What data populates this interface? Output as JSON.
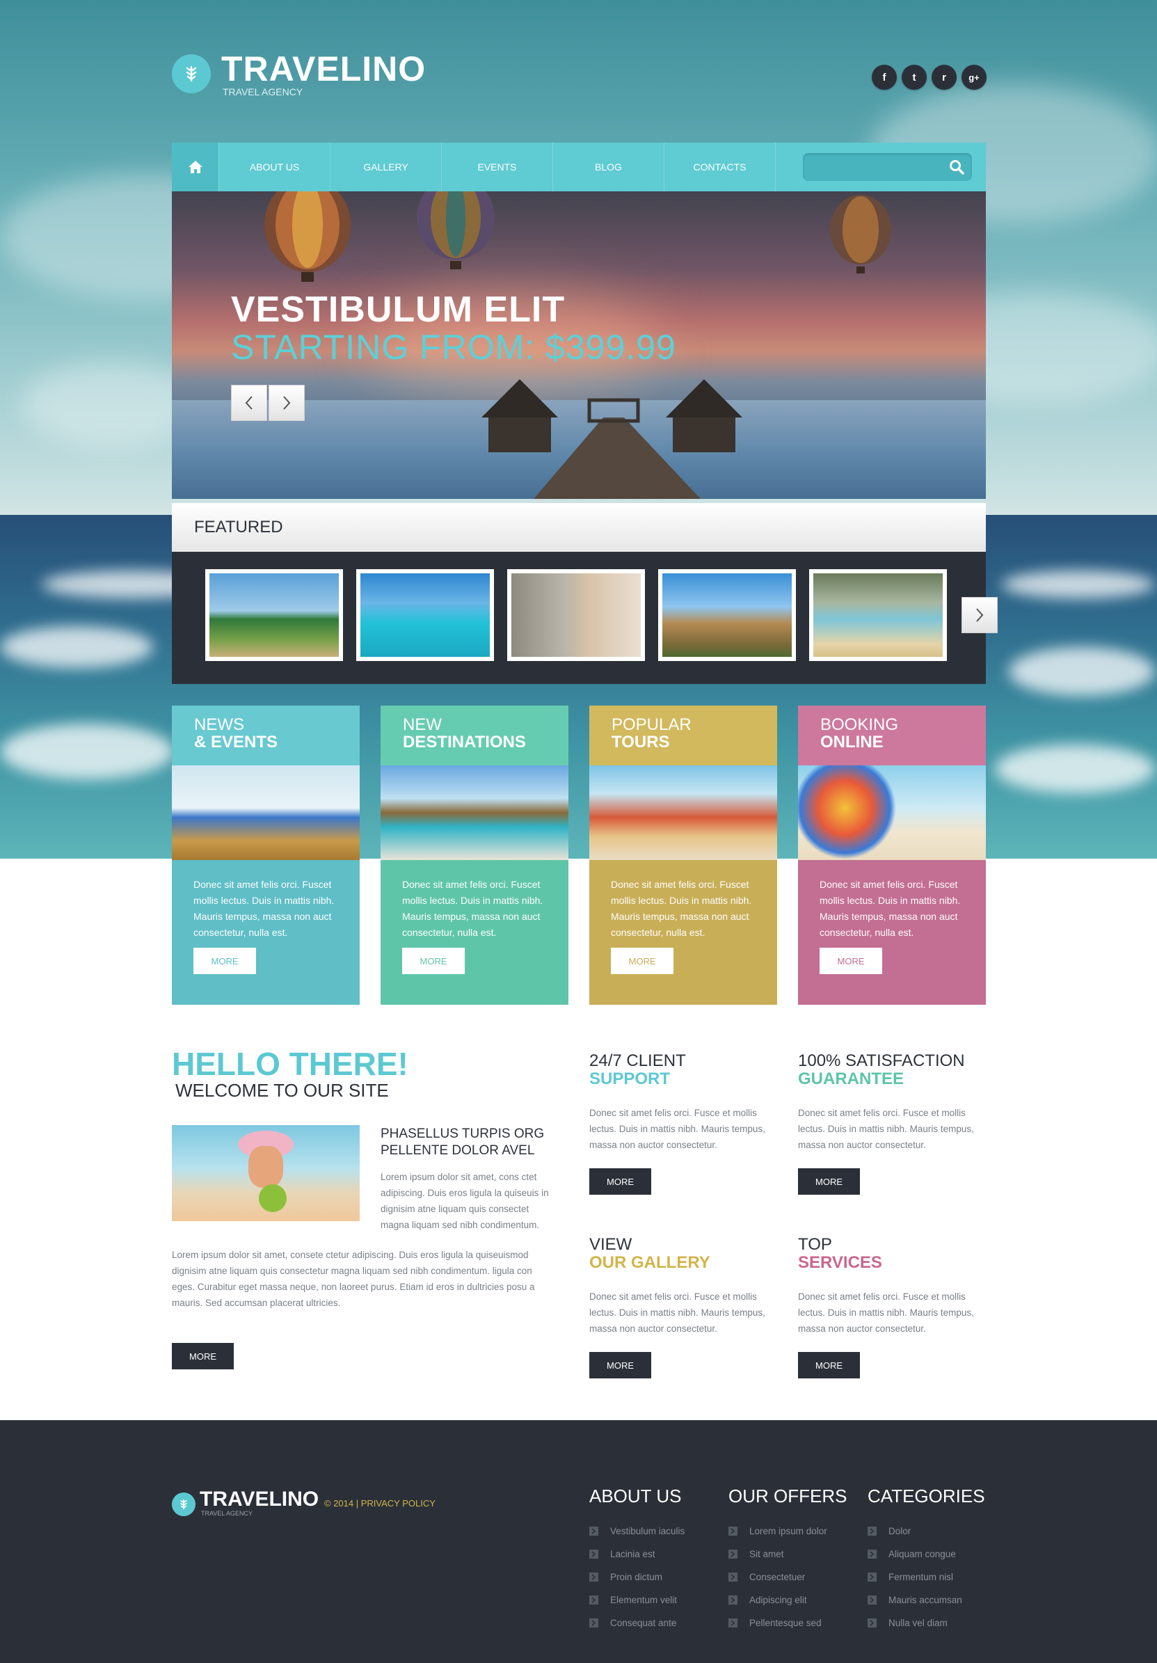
{
  "header": {
    "logo_title": "TRAVELINO",
    "logo_subtitle": "TRAVEL AGENCY",
    "social": [
      {
        "icon": "facebook-icon",
        "glyph": "f"
      },
      {
        "icon": "twitter-icon",
        "glyph": "t"
      },
      {
        "icon": "rss-icon",
        "glyph": "r"
      },
      {
        "icon": "google-plus-icon",
        "glyph": "g+"
      }
    ]
  },
  "nav": {
    "home_icon": "home-icon",
    "items": [
      "ABOUT US",
      "GALLERY",
      "EVENTS",
      "BLOG",
      "CONTACTS"
    ],
    "search_placeholder": ""
  },
  "hero": {
    "title": "VESTIBULUM ELIT",
    "subtitle": "STARTING FROM: $399.99"
  },
  "featured": {
    "title": "FEATURED"
  },
  "cards": [
    {
      "line1": "NEWS",
      "line2": "& EVENTS",
      "text": "Donec sit amet felis orci. Fuscet mollis lectus. Duis in mattis nibh. Mauris tempus, massa non auct consectetur, nulla est.",
      "button": "MORE",
      "color": "#5fbec6"
    },
    {
      "line1": "NEW",
      "line2": "DESTINATIONS",
      "text": "Donec sit amet felis orci. Fuscet mollis lectus. Duis in mattis nibh. Mauris tempus, massa non auct consectetur, nulla est.",
      "button": "MORE",
      "color": "#5fc5a9"
    },
    {
      "line1": "POPULAR",
      "line2": "TOURS",
      "text": "Donec sit amet felis orci. Fuscet mollis lectus. Duis in mattis nibh. Mauris tempus, massa non auct consectetur, nulla est.",
      "button": "MORE",
      "color": "#c8ae57"
    },
    {
      "line1": "BOOKING",
      "line2": "ONLINE",
      "text": "Donec sit amet felis orci. Fuscet mollis lectus. Duis in mattis nibh. Mauris tempus, massa non auct consectetur, nulla est.",
      "button": "MORE",
      "color": "#c36e93"
    }
  ],
  "hello": {
    "title": "HELLO THERE!",
    "subtitle": "WELCOME TO OUR SITE",
    "side_title_1": "PHASELLUS TURPIS ORG",
    "side_title_2": "PELLENTE DOLOR AVEL",
    "side_text": "Lorem ipsum dolor sit amet, cons ctet adipiscing. Duis eros ligula la quiseuis in dignisim atne liquam quis consectet magna liquam sed nibh condimentum.",
    "text": "Lorem ipsum dolor sit amet, consete ctetur adipiscing. Duis eros ligula la quiseuismod dignisim atne liquam quis consectetur magna liquam sed nibh condimentum. ligula con eges. Curabitur eget massa neque, non laoreet purus. Etiam id eros in dultricies posu a mauris. Sed accumsan placerat ultricies.",
    "button": "MORE"
  },
  "features": [
    {
      "line1": "24/7 CLIENT",
      "line2": "SUPPORT",
      "color": "#5cc9d2",
      "text": "Donec sit amet felis orci. Fusce et mollis lectus. Duis in mattis nibh. Mauris tempus, massa non auctor consectetur.",
      "button": "MORE"
    },
    {
      "line1": "100% SATISFACTION",
      "line2": "GUARANTEE",
      "color": "#5cc6a6",
      "text": "Donec sit amet felis orci. Fusce et mollis lectus. Duis in mattis nibh. Mauris tempus, massa non auctor consectetur.",
      "button": "MORE"
    },
    {
      "line1": "VIEW",
      "line2": "OUR GALLERY",
      "color": "#d2b54a",
      "text": "Donec sit amet felis orci. Fusce et mollis lectus. Duis in mattis nibh. Mauris tempus, massa non auctor consectetur.",
      "button": "MORE"
    },
    {
      "line1": "TOP",
      "line2": "SERVICES",
      "color": "#c9678f",
      "text": "Donec sit amet felis orci. Fusce et mollis lectus. Duis in mattis nibh. Mauris tempus, massa non auctor consectetur.",
      "button": "MORE"
    }
  ],
  "footer": {
    "logo_title": "TRAVELINO",
    "logo_subtitle": "TRAVEL AGENCY",
    "copyright": "© 2014 | PRIVACY POLICY",
    "columns": [
      {
        "title": "ABOUT US",
        "links": [
          "Vestibulum iaculis",
          "Lacinia est",
          "Proin dictum",
          "Elementum velit",
          "Consequat ante"
        ]
      },
      {
        "title": "OUR OFFERS",
        "links": [
          "Lorem ipsum dolor",
          "Sit amet",
          "Consectetuer",
          "Adipiscing elit",
          "Pellentesque sed"
        ]
      },
      {
        "title": "CATEGORIES",
        "links": [
          "Dolor",
          "Aliquam congue",
          "Fermentum nisl",
          "Mauris accumsan",
          "Nulla vel diam"
        ]
      }
    ]
  }
}
